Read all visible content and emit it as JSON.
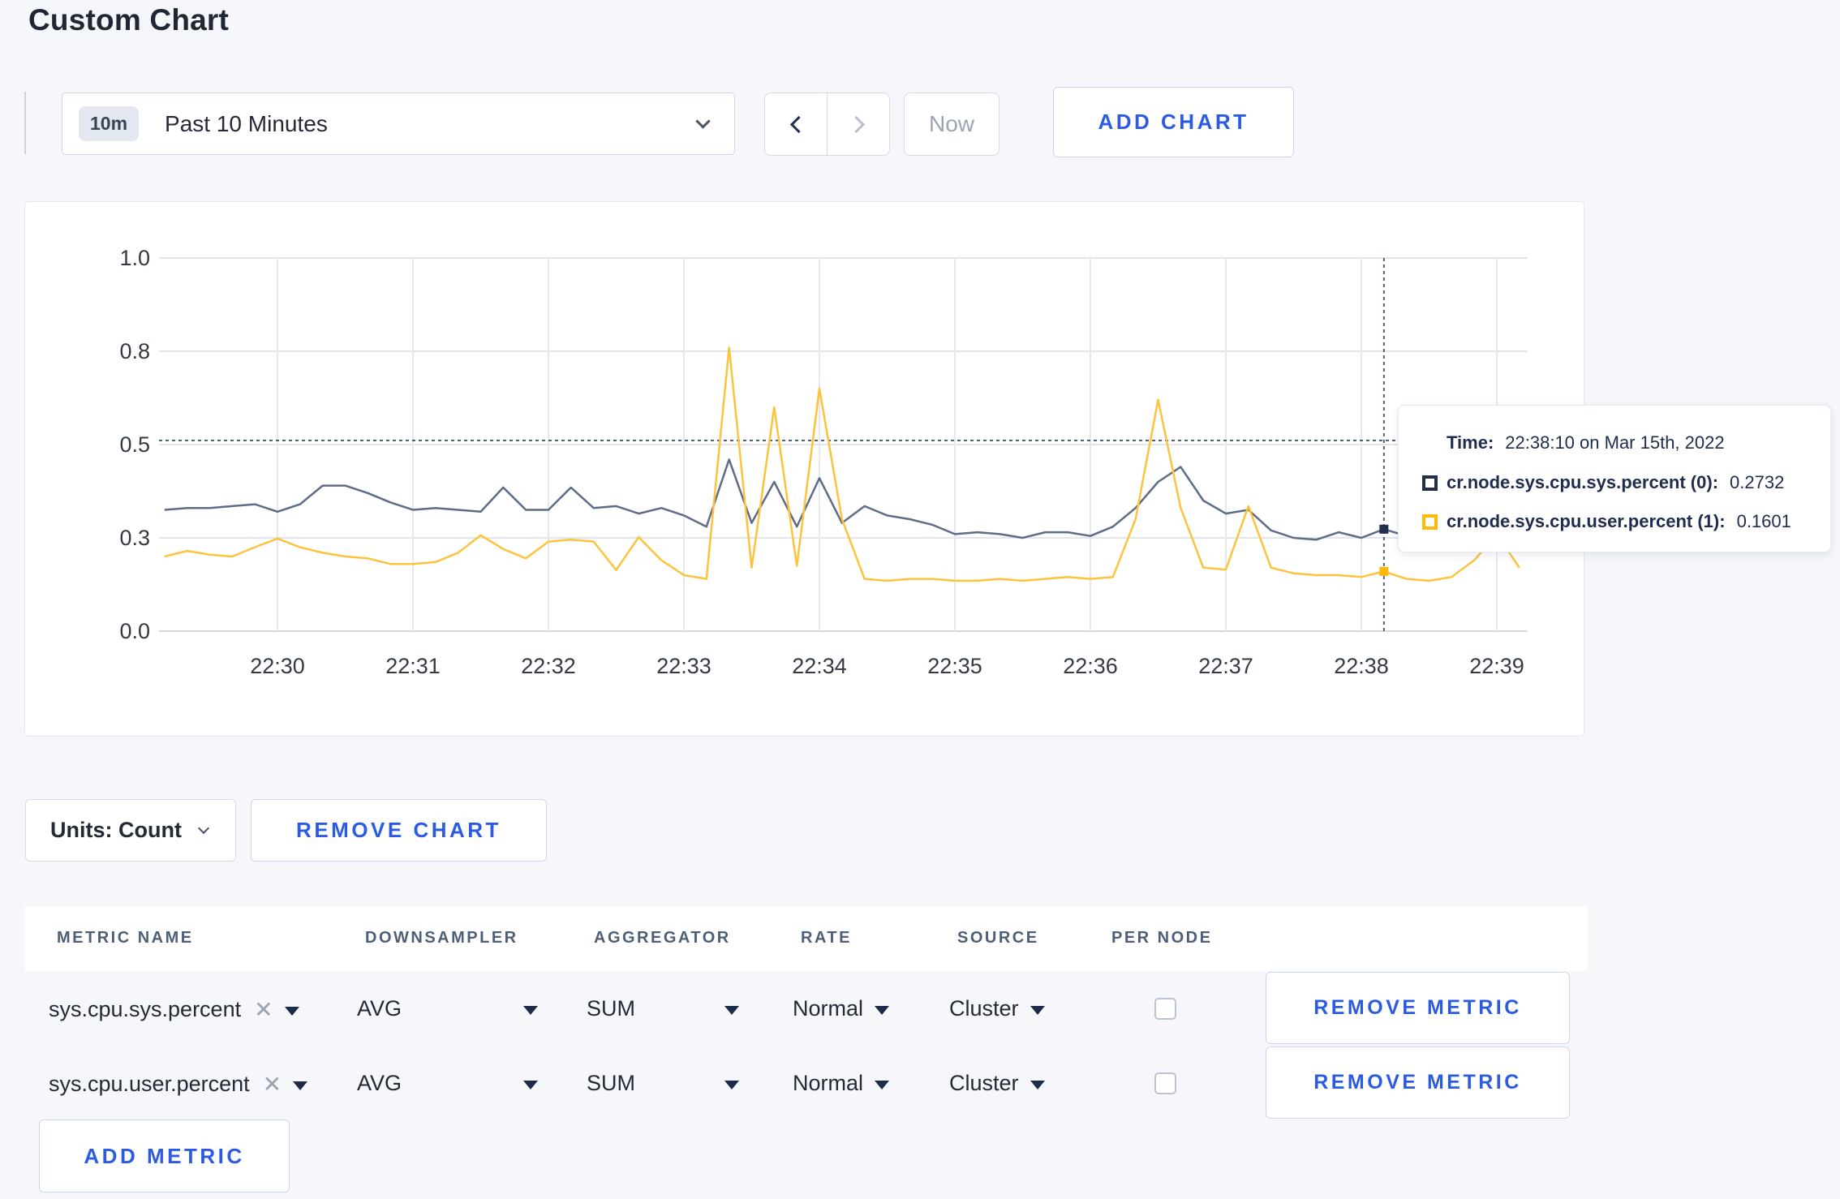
{
  "page": {
    "title": "Custom Chart"
  },
  "toolbar": {
    "time_badge": "10m",
    "time_label": "Past 10 Minutes",
    "now_label": "Now",
    "add_chart_label": "ADD CHART"
  },
  "chart_controls": {
    "units_label": "Units: Count",
    "remove_chart_label": "REMOVE CHART"
  },
  "tooltip": {
    "time_label": "Time:",
    "time_value": "22:38:10 on Mar 15th, 2022",
    "series": [
      {
        "label": "cr.node.sys.cpu.sys.percent (0):",
        "value": "0.2732",
        "color": "#242f4e"
      },
      {
        "label": "cr.node.sys.cpu.user.percent (1):",
        "value": "0.1601",
        "color": "#ffb90a"
      }
    ]
  },
  "metrics_table": {
    "headers": [
      "METRIC NAME",
      "DOWNSAMPLER",
      "AGGREGATOR",
      "RATE",
      "SOURCE",
      "PER NODE"
    ],
    "rows": [
      {
        "metric": "sys.cpu.sys.percent",
        "downsampler": "AVG",
        "aggregator": "SUM",
        "rate": "Normal",
        "source": "Cluster",
        "per_node": false
      },
      {
        "metric": "sys.cpu.user.percent",
        "downsampler": "AVG",
        "aggregator": "SUM",
        "rate": "Normal",
        "source": "Cluster",
        "per_node": false
      }
    ],
    "remove_metric_label": "REMOVE METRIC",
    "add_metric_label": "ADD METRIC"
  },
  "chart_data": {
    "type": "line",
    "x_start": "22:29:10",
    "x_step_seconds": 10,
    "x_ticks": [
      "22:30",
      "22:31",
      "22:32",
      "22:33",
      "22:34",
      "22:35",
      "22:36",
      "22:37",
      "22:38",
      "22:39"
    ],
    "y_ticks": [
      "0.0",
      "0.3",
      "0.5",
      "0.8",
      "1.0"
    ],
    "y_tick_values": [
      0,
      0.25,
      0.5,
      0.75,
      1.0
    ],
    "ylim": [
      0,
      1
    ],
    "grid": true,
    "series": [
      {
        "name": "cr.node.sys.cpu.sys.percent",
        "color": "#5f6c87",
        "values": [
          0.325,
          0.33,
          0.33,
          0.335,
          0.34,
          0.32,
          0.34,
          0.39,
          0.39,
          0.37,
          0.345,
          0.325,
          0.33,
          0.325,
          0.32,
          0.385,
          0.325,
          0.325,
          0.385,
          0.33,
          0.335,
          0.315,
          0.33,
          0.31,
          0.28,
          0.46,
          0.29,
          0.4,
          0.28,
          0.41,
          0.29,
          0.335,
          0.31,
          0.3,
          0.285,
          0.26,
          0.265,
          0.26,
          0.25,
          0.265,
          0.265,
          0.255,
          0.28,
          0.33,
          0.4,
          0.44,
          0.35,
          0.315,
          0.325,
          0.27,
          0.25,
          0.245,
          0.265,
          0.25,
          0.2732,
          0.255,
          0.245,
          0.24,
          0.25,
          0.265,
          0.26
        ]
      },
      {
        "name": "cr.node.sys.cpu.user.percent",
        "color": "#fdc33c",
        "values": [
          0.2,
          0.215,
          0.205,
          0.2,
          0.225,
          0.248,
          0.225,
          0.21,
          0.2,
          0.195,
          0.18,
          0.18,
          0.185,
          0.21,
          0.257,
          0.22,
          0.195,
          0.24,
          0.245,
          0.24,
          0.164,
          0.252,
          0.19,
          0.15,
          0.14,
          0.76,
          0.17,
          0.6,
          0.175,
          0.65,
          0.3,
          0.14,
          0.135,
          0.14,
          0.14,
          0.135,
          0.135,
          0.14,
          0.135,
          0.14,
          0.145,
          0.14,
          0.145,
          0.3,
          0.62,
          0.33,
          0.17,
          0.165,
          0.335,
          0.17,
          0.155,
          0.15,
          0.15,
          0.145,
          0.1601,
          0.14,
          0.135,
          0.145,
          0.19,
          0.26,
          0.17
        ]
      }
    ],
    "crosshair": {
      "time": "22:38:10",
      "x_index": 54,
      "y_value": 0.511
    }
  }
}
